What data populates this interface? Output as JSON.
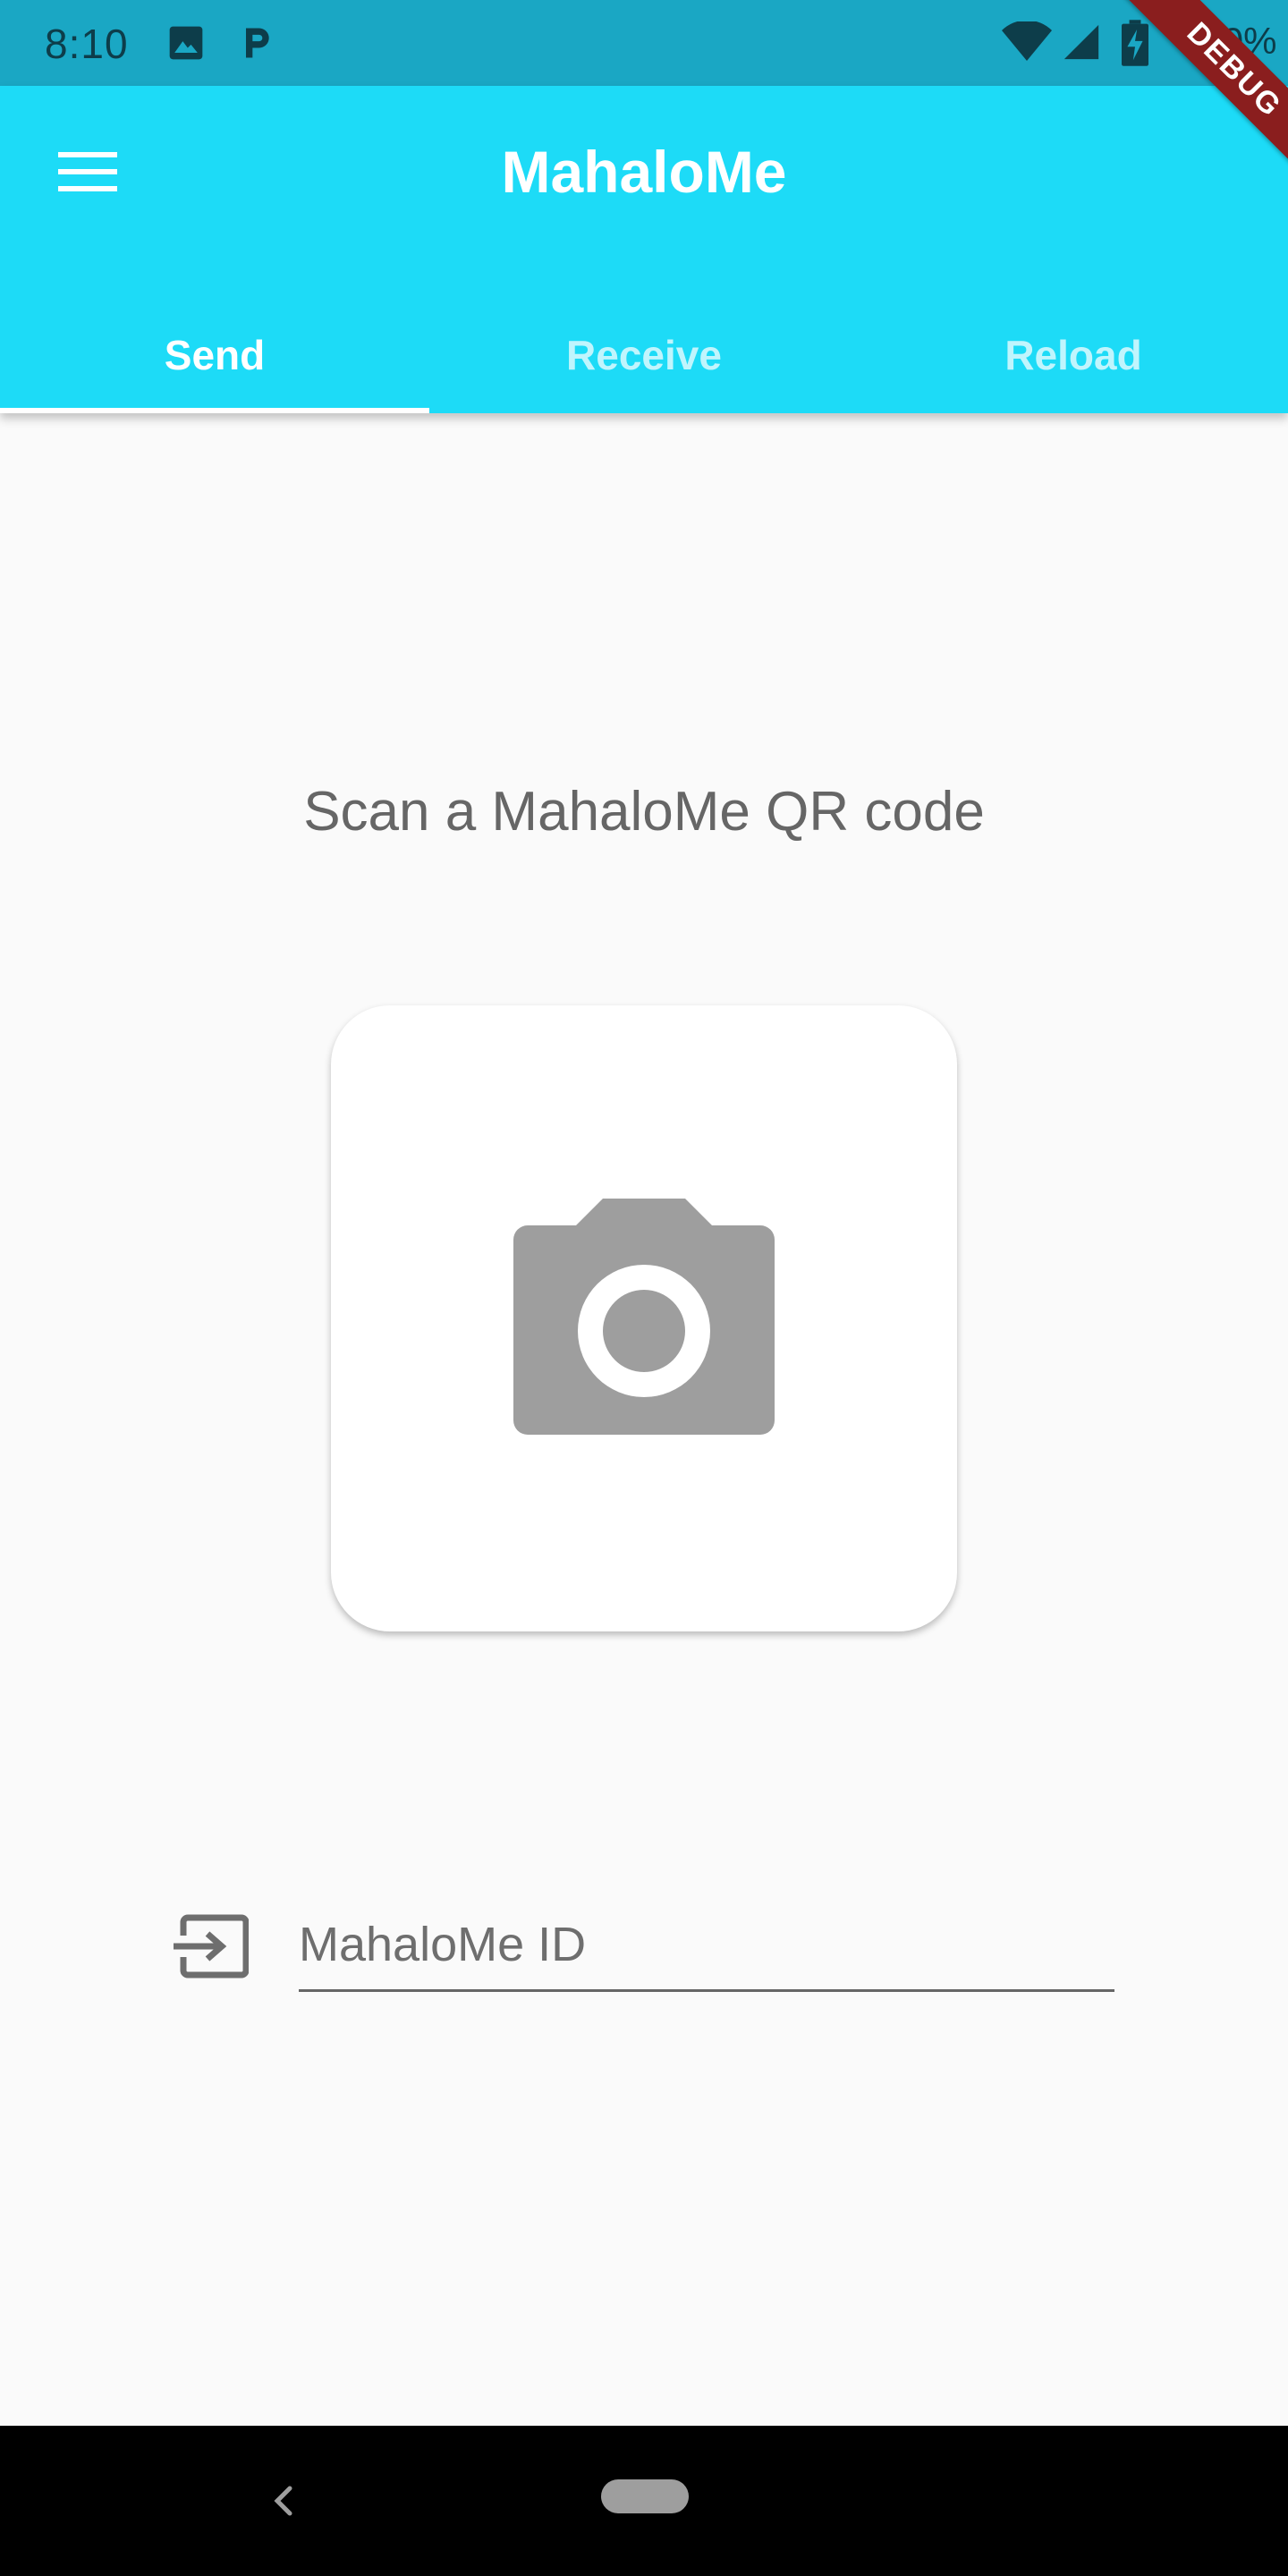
{
  "status_bar": {
    "time": "8:10",
    "battery_text": "100%",
    "icons": [
      "image-icon",
      "parking-icon",
      "wifi-icon",
      "signal-icon",
      "battery-charging-icon"
    ]
  },
  "app_bar": {
    "title": "MahaloMe",
    "menu_icon": "menu-icon",
    "tabs": [
      {
        "label": "Send",
        "active": true
      },
      {
        "label": "Receive",
        "active": false
      },
      {
        "label": "Reload",
        "active": false
      }
    ],
    "background_color": "#1ddbf7"
  },
  "debug_banner": "DEBUG",
  "send": {
    "scan_title": "Scan a MahaloMe QR code",
    "camera_icon": "camera-icon",
    "id_field": {
      "icon": "input-icon",
      "placeholder": "MahaloMe ID",
      "value": ""
    }
  },
  "nav_bar": {
    "back_icon": "back-icon",
    "home_icon": "home-pill"
  }
}
